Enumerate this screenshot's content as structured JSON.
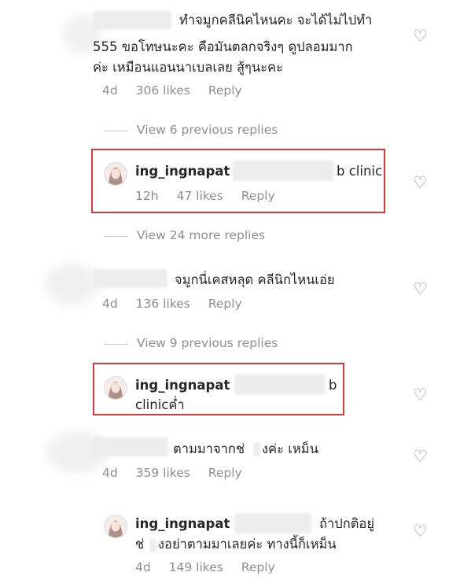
{
  "comments": [
    {
      "line1": "ทำจมูกคลีนิคไหนคะ จะได้ไม่ไปทำ",
      "line2": "555 ขอโทษนะคะ คือมันตลกจริงๆ ดูปลอมมาก",
      "line3": "ค่ะ เหมือนแอนนาเบลเลย สู้ๆนะคะ",
      "time": "4d",
      "likes": "306 likes",
      "reply": "Reply"
    },
    {
      "view_replies": "View 6 previous replies",
      "username": "ing_ingnapat",
      "text": "b clinic",
      "time": "12h",
      "likes": "47 likes",
      "reply": "Reply"
    },
    {
      "view_replies": "View 24 more replies",
      "text": "จมูกนี่เคสหลุด คลีนิกไหนเอ่ย",
      "time": "4d",
      "likes": "136 likes",
      "reply": "Reply"
    },
    {
      "view_replies": "View 9 previous replies",
      "username": "ing_ingnapat",
      "text_end": "b",
      "line2": "clinicค่ำ"
    },
    {
      "text": "ตามมาจากช่",
      "text_end": "งค่ะ เหม็น",
      "time": "4d",
      "likes": "359 likes",
      "reply": "Reply"
    },
    {
      "username": "ing_ingnapat",
      "text_end": "ถ้าปกติอยู่",
      "line2_start": "ช่",
      "line2_end": "งอย่าตามมาเลยค่ะ ทางนี้ก็เหม็น",
      "time": "4d",
      "likes": "149 likes",
      "reply": "Reply"
    }
  ],
  "icons": {
    "heart": "♡",
    "heart_name": "heart-outline-icon"
  },
  "colors": {
    "highlight": "#d63a3a",
    "meta": "#8e8e8e",
    "text": "#262626"
  }
}
